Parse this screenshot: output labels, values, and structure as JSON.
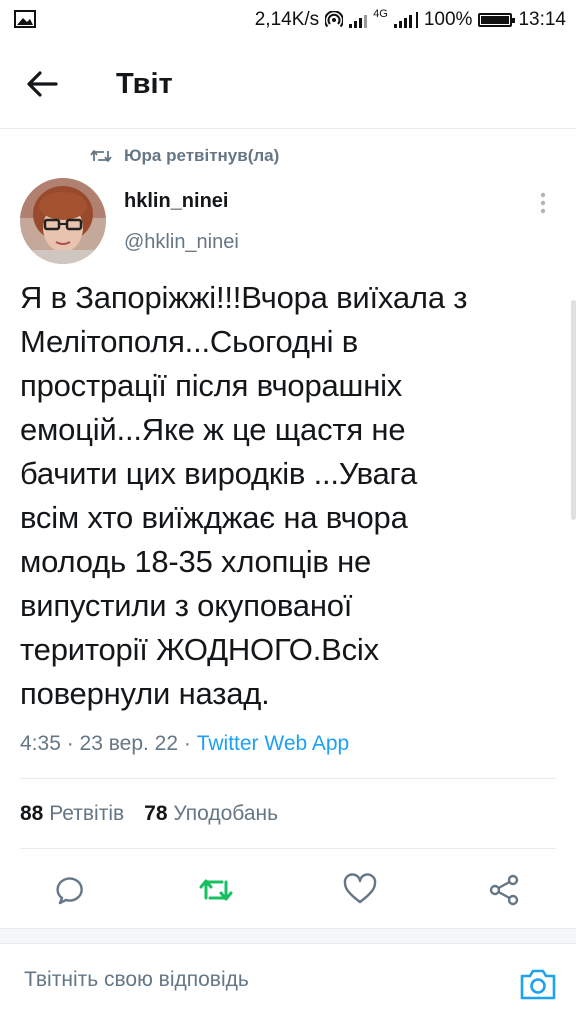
{
  "status_bar": {
    "speed": "2,14K/s",
    "network": "4G",
    "battery": "100%",
    "battery_level": 1.0,
    "time": "13:14"
  },
  "header": {
    "title": "Твіт",
    "back_icon": "arrow-left-icon"
  },
  "retweet": {
    "label": "Юра ретвітнув(ла)",
    "icon": "retweet-icon"
  },
  "author": {
    "name": "hklin_ninei",
    "handle": "@hklin_ninei"
  },
  "tweet": {
    "lines": [
      "Я в Запоріжжі!!!Вчора виїхала з",
      "Мелітополя...Сьогодні в",
      "прострації після вчорашніх",
      "емоцій...Яке ж це щастя не",
      "бачити цих виродків ...Увага",
      "всім хто виїжджає на вчора",
      "молодь 18-35 хлопців не",
      "випустили з окупованої",
      "території ЖОДНОГО.Всіх",
      "повернули назад."
    ],
    "timestamp": "4:35 · 23 вер. 22 · ",
    "app": "Twitter Web App"
  },
  "stats": {
    "retweets_count": "88",
    "retweets_label": "Ретвітів",
    "likes_count": "78",
    "likes_label": "Уподобань"
  },
  "actions": {
    "reply_icon": "comment-icon",
    "retweet_icon": "retweet-icon",
    "like_icon": "heart-icon",
    "share_icon": "share-icon",
    "retweet_color": "#17bf63"
  },
  "reply_box": {
    "placeholder": "Твітніть свою відповідь",
    "camera_icon": "camera-icon"
  },
  "colors": {
    "accent": "#1da1f2",
    "secondary_text": "#657786",
    "divider": "#e6ecf0"
  }
}
